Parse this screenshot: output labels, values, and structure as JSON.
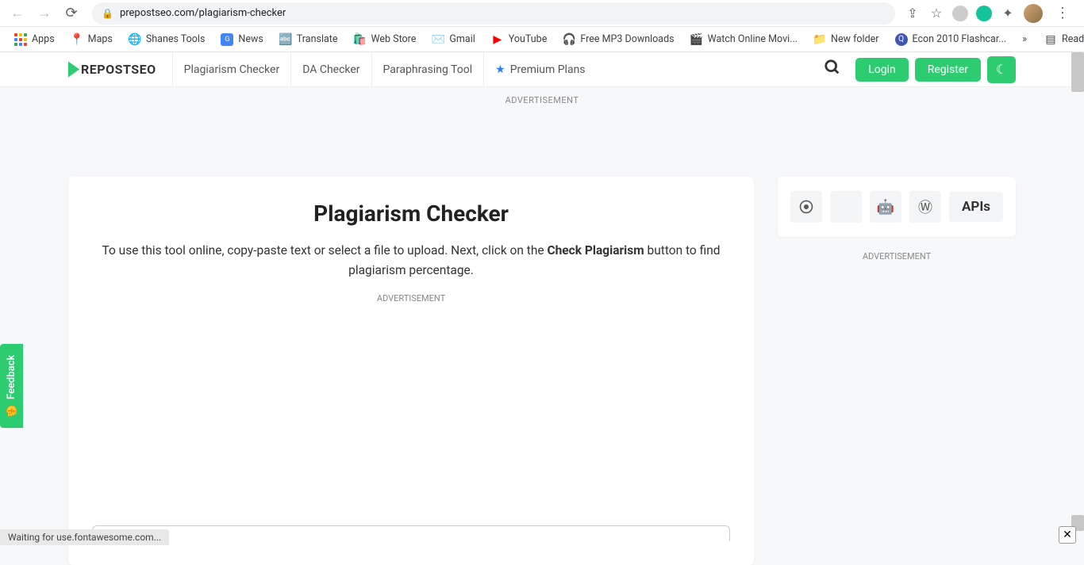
{
  "browser": {
    "url": "prepostseo.com/plagiarism-checker",
    "status": "Waiting for use.fontawesome.com..."
  },
  "bookmarks": [
    {
      "label": "Apps",
      "icon": "apps"
    },
    {
      "label": "Maps",
      "icon": "maps"
    },
    {
      "label": "Shanes Tools",
      "icon": "globe"
    },
    {
      "label": "News",
      "icon": "news"
    },
    {
      "label": "Translate",
      "icon": "translate"
    },
    {
      "label": "Web Store",
      "icon": "webstore"
    },
    {
      "label": "Gmail",
      "icon": "gmail"
    },
    {
      "label": "YouTube",
      "icon": "youtube"
    },
    {
      "label": "Free MP3 Downloads",
      "icon": "headphones"
    },
    {
      "label": "Watch Online Movi...",
      "icon": "movie"
    },
    {
      "label": "New folder",
      "icon": "folder"
    },
    {
      "label": "Econ 2010 Flashcar...",
      "icon": "quizlet"
    }
  ],
  "bookmarks_overflow": "»",
  "reading_list": "Reading list",
  "nav": {
    "logo": "REPOSTSEO",
    "links": [
      "Plagiarism Checker",
      "DA Checker",
      "Paraphrasing Tool",
      "Premium Plans"
    ],
    "login": "Login",
    "register": "Register"
  },
  "ads": {
    "top": "ADVERTISEMENT",
    "inner": "ADVERTISEMENT",
    "side": "ADVERTISEMENT"
  },
  "main": {
    "title": "Plagiarism Checker",
    "desc_pre": "To use this tool online, copy-paste text or select a file to upload. Next, click on the ",
    "desc_bold": "Check Plagiarism",
    "desc_post": " button to find plagiarism percentage."
  },
  "sidebar": {
    "apis": "APIs"
  },
  "feedback": "Feedback"
}
